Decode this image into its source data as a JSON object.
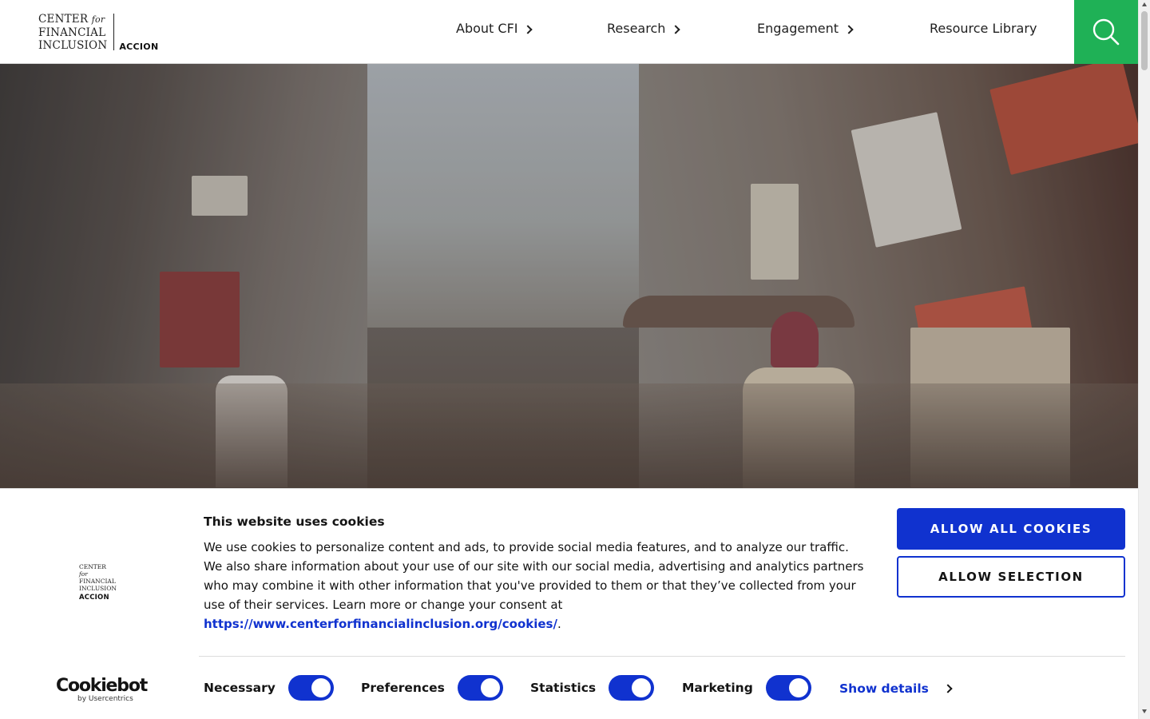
{
  "header": {
    "logo": {
      "line1": "CENTER",
      "line1_for": "for",
      "line2": "FINANCIAL",
      "line3": "INCLUSION",
      "brand": "ACCION"
    },
    "nav": [
      {
        "label": "About CFI",
        "has_chevron": true
      },
      {
        "label": "Research",
        "has_chevron": true
      },
      {
        "label": "Engagement",
        "has_chevron": true
      },
      {
        "label": "Resource Library",
        "has_chevron": false
      }
    ],
    "search_icon": "search-icon",
    "accent_color": "#1fb156"
  },
  "hero": {
    "image": "busy-street-market-photo"
  },
  "cookie_banner": {
    "logo": {
      "line1": "CENTER",
      "line1_for": "for",
      "line2": "FINANCIAL",
      "line3": "INCLUSION",
      "brand": "ACCION"
    },
    "title": "This website uses cookies",
    "body": "We use cookies to personalize content and ads, to provide social media features, and to analyze our traffic. We also share information about your use of our site with our social media, advertising and analytics partners who may combine it with other information that you've provided to them or that they’ve collected from your use of their services. Learn more or change your consent at ",
    "link": "https://www.centerforfinancialinclusion.org/cookies/",
    "body_end": ".",
    "allow_all": "ALLOW ALL COOKIES",
    "allow_selection": "ALLOW SELECTION",
    "toggles": [
      {
        "label": "Necessary",
        "checked": true
      },
      {
        "label": "Preferences",
        "checked": true
      },
      {
        "label": "Statistics",
        "checked": true
      },
      {
        "label": "Marketing",
        "checked": true
      }
    ],
    "show_details": "Show details",
    "cookiebot": {
      "name": "Cookiebot",
      "by": "by Usercentrics"
    },
    "primary_color": "#1032cf"
  }
}
